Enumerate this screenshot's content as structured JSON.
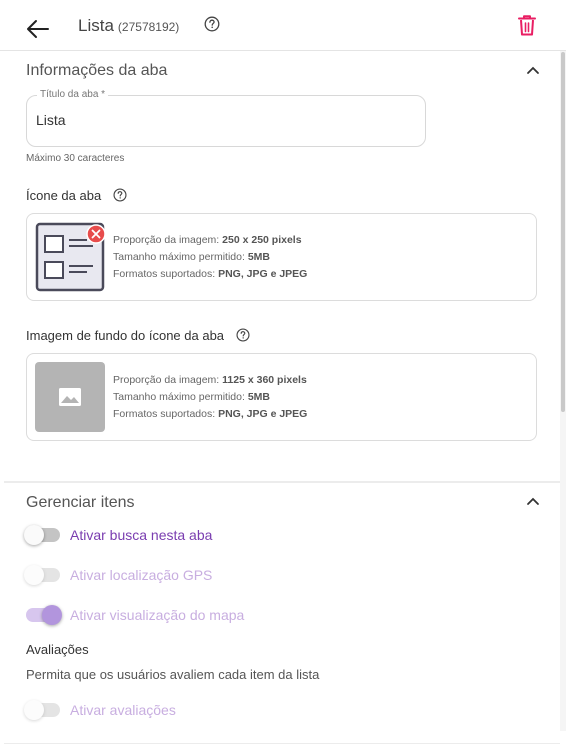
{
  "header": {
    "title": "Lista",
    "id": "(27578192)"
  },
  "tab_info": {
    "section_title": "Informações da aba",
    "title_field": {
      "label": "Título da aba *",
      "value": "Lista"
    },
    "title_hint": "Máximo 30 caracteres",
    "icon": {
      "label": "Ícone da aba",
      "proportion_label": "Proporção da imagem:",
      "proportion_value": "250 x 250 pixels",
      "maxsize_label": "Tamanho máximo permitido:",
      "maxsize_value": "5MB",
      "formats_label": "Formatos suportados:",
      "formats_value": "PNG, JPG e JPEG"
    },
    "bg_icon": {
      "label": "Imagem de fundo do ícone da aba",
      "proportion_label": "Proporção da imagem:",
      "proportion_value": "1125 x 360 pixels",
      "maxsize_label": "Tamanho máximo permitido:",
      "maxsize_value": "5MB",
      "formats_label": "Formatos suportados:",
      "formats_value": "PNG, JPG e JPEG"
    }
  },
  "manage": {
    "section_title": "Gerenciar itens",
    "toggles": [
      {
        "label": "Ativar busca nesta aba",
        "on": false,
        "disabled": false
      },
      {
        "label": "Ativar localização GPS",
        "on": false,
        "disabled": true
      },
      {
        "label": "Ativar visualização do mapa",
        "on": true,
        "disabled": true
      }
    ],
    "ratings_heading": "Avaliações",
    "ratings_desc": "Permita que os usuários avaliem cada item da lista",
    "ratings_toggle": {
      "label": "Ativar avaliações",
      "on": false,
      "disabled": true
    }
  },
  "colors": {
    "accent_purple": "#7a3db0",
    "danger_pink": "#e91e63"
  }
}
